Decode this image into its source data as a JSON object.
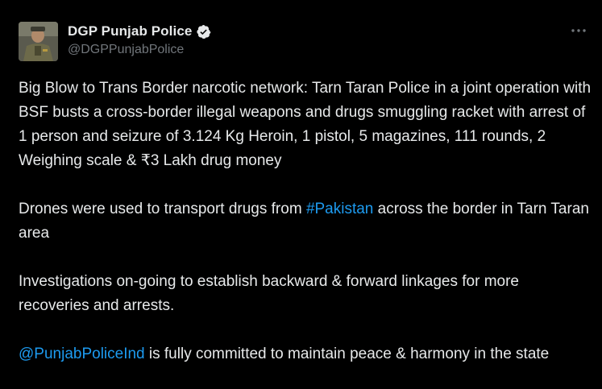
{
  "author": {
    "display_name": "DGP Punjab Police",
    "handle": "@DGPPunjabPolice",
    "verified_icon": "verified-badge-icon",
    "verified_color": "#e7e9ea"
  },
  "menu": {
    "icon": "more-horizontal-icon"
  },
  "tweet": {
    "p1": "Big Blow to Trans Border narcotic network: Tarn Taran Police in a joint operation with BSF busts a cross-border illegal weapons and drugs smuggling racket with arrest of 1 person and seizure of 3.124 Kg Heroin, 1 pistol, 5 magazines, 111 rounds, 2 Weighing scale & ₹3 Lakh drug money",
    "p2_before": "Drones were used to transport drugs from ",
    "p2_hashtag": "#Pakistan",
    "p2_after": " across the border in Tarn Taran area",
    "p3": "Investigations on-going to establish backward & forward linkages for more recoveries and arrests.",
    "p4_mention": "@PunjabPoliceInd",
    "p4_after": " is fully committed to maintain peace & harmony in the state"
  },
  "colors": {
    "background": "#000000",
    "text": "#e7e9ea",
    "secondary": "#71767b",
    "link": "#1d9bf0"
  }
}
